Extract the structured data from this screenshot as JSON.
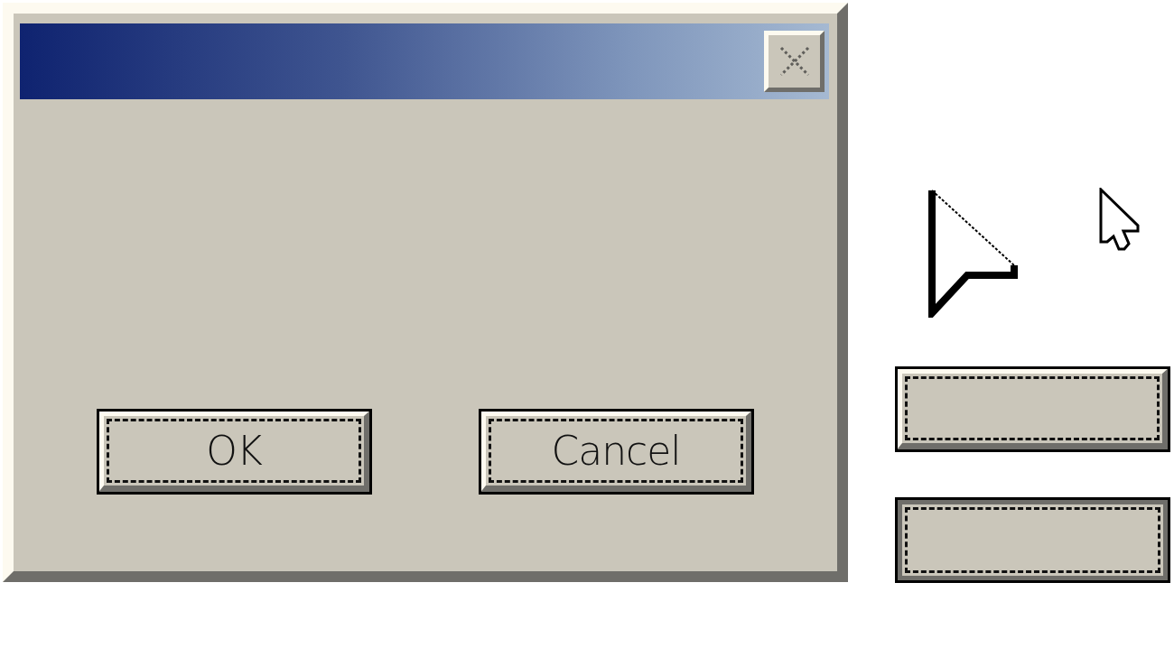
{
  "dialog": {
    "buttons": [
      {
        "label": "OK",
        "focused": true,
        "pressed": false
      },
      {
        "label": "Cancel",
        "focused": true,
        "pressed": false
      }
    ]
  },
  "sample_buttons": [
    {
      "focused": true,
      "pressed": false
    },
    {
      "focused": true,
      "pressed": true
    }
  ]
}
